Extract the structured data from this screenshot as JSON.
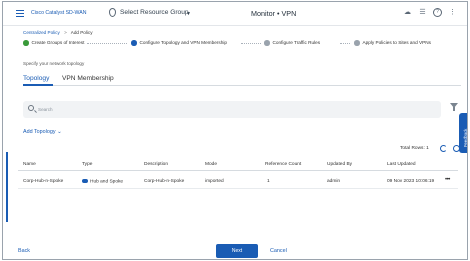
{
  "header": {
    "brand": "Cisco Catalyst SD-WAN",
    "resource_group": "Select Resource Group",
    "title": "Monitor • VPN"
  },
  "breadcrumb": {
    "link": "Centralized Policy",
    "separator": ">",
    "current": "Add Policy"
  },
  "stepper": {
    "steps": [
      {
        "label": "Create Groups of Interest",
        "status": "done"
      },
      {
        "label": "Configure Topology and VPN Membership",
        "status": "active"
      },
      {
        "label": "Configure Traffic Rules",
        "status": "todo"
      },
      {
        "label": "Apply Policies to Sites and VPNs",
        "status": "todo"
      }
    ]
  },
  "intro_text": "Specify your network topology",
  "tabs": [
    {
      "label": "Topology",
      "active": true
    },
    {
      "label": "VPN Membership",
      "active": false
    }
  ],
  "search": {
    "placeholder": "Search"
  },
  "add_topology": "Add Topology",
  "total_rows": "Total Rows: 1",
  "feedback": "Feedback",
  "table": {
    "columns": [
      "Name",
      "Type",
      "Description",
      "Mode",
      "Reference Count",
      "Updated By",
      "Last Updated"
    ],
    "rows": [
      {
        "name": "Corp-Hub-n-Spoke",
        "type": "Hub and Spoke",
        "description": "Corp-Hub-n-Spoke",
        "mode": "imported",
        "reference_count": "1",
        "updated_by": "admin",
        "last_updated": "09 Nov 2023 10:06:19"
      }
    ]
  },
  "footer": {
    "back": "Back",
    "next": "Next",
    "cancel": "Cancel"
  },
  "colors": {
    "accent": "#1a5cb4",
    "step_done": "#3a9a3a",
    "step_todo": "#9aa3ad"
  }
}
